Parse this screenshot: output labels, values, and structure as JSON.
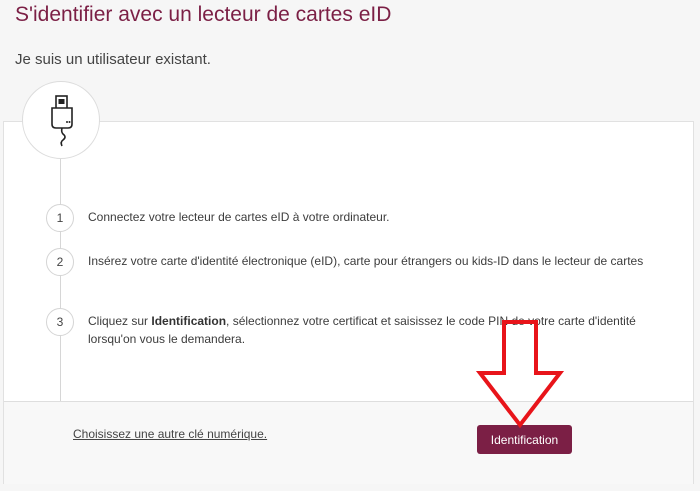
{
  "header": {
    "title": "S'identifier avec un lecteur de cartes eID",
    "subtitle": "Je suis un utilisateur existant."
  },
  "steps": [
    {
      "number": "1",
      "text": "Connectez votre lecteur de cartes eID à votre ordinateur."
    },
    {
      "number": "2",
      "text": "Insérez votre carte d'identité électronique (eID), carte pour étrangers ou kids-ID dans le lecteur de cartes"
    },
    {
      "number": "3",
      "text_before": "Cliquez sur ",
      "text_bold": "Identification",
      "text_after": ", sélectionnez votre certificat et saisissez le code PIN de votre carte d'identité lorsqu'on vous le demandera."
    }
  ],
  "footer": {
    "alt_link": "Choisissez une autre clé numérique.",
    "button_label": "Identification"
  },
  "colors": {
    "brand": "#7b1f45",
    "annotation_arrow": "#e8141a"
  },
  "icons": {
    "reader": "card-reader-icon",
    "arrow": "red-down-arrow"
  }
}
